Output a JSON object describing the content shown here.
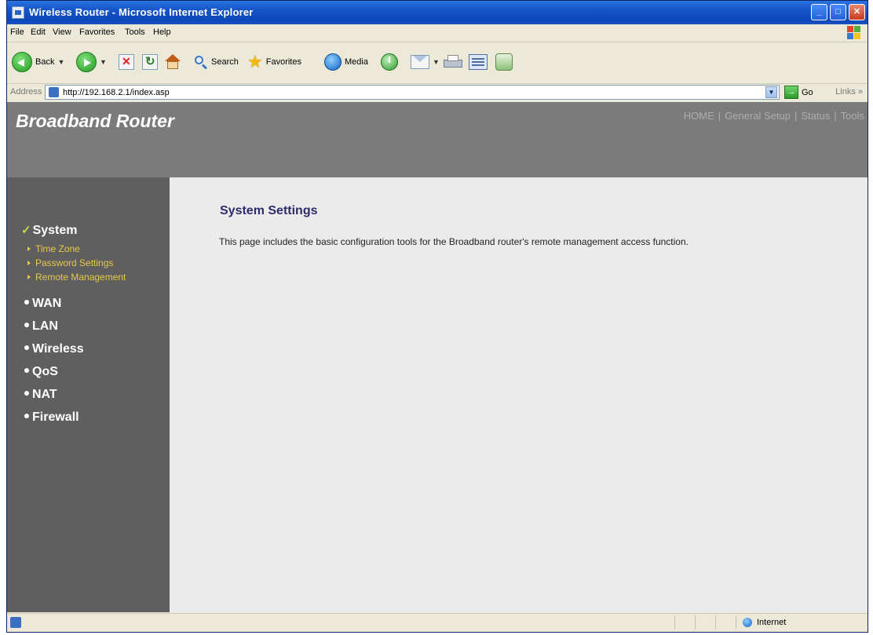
{
  "window": {
    "title": "Wireless Router - Microsoft Internet Explorer"
  },
  "menu": [
    "File",
    "Edit",
    "View",
    "Favorites",
    "Tools",
    "Help"
  ],
  "toolbar": {
    "back": "Back",
    "search": "Search",
    "favorites": "Favorites",
    "media": "Media"
  },
  "address": {
    "label": "Address",
    "url": "http://192.168.2.1/index.asp",
    "go": "Go",
    "links": "Links »"
  },
  "header": {
    "brand": "Broadband Router",
    "topnav": [
      "HOME",
      "General Setup",
      "Status",
      "Tools"
    ]
  },
  "sidebar": {
    "active": "System",
    "subitems": [
      "Time Zone",
      "Password Settings",
      "Remote Management"
    ],
    "items": [
      "WAN",
      "LAN",
      "Wireless",
      "QoS",
      "NAT",
      "Firewall"
    ]
  },
  "main": {
    "title": "System Settings",
    "description": "This page includes the basic configuration tools for the Broadband router's remote management access function."
  },
  "status": {
    "zone": "Internet"
  },
  "icons": {
    "app": "ie-page-icon",
    "back": "back-arrow-icon",
    "forward": "forward-arrow-icon",
    "stop": "stop-icon",
    "refresh": "refresh-icon",
    "home": "home-icon",
    "search": "search-icon",
    "favorites": "star-icon",
    "media": "media-globe-icon",
    "history": "history-icon",
    "mail": "mail-icon",
    "print": "printer-icon",
    "edit": "edit-icon",
    "messenger": "messenger-icon"
  }
}
